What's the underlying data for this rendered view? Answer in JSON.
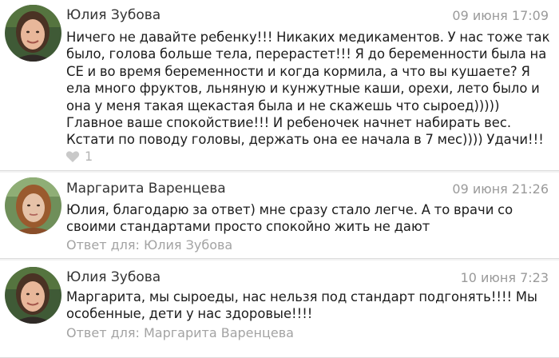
{
  "comments": [
    {
      "author": "Юлия Зубова",
      "date": "09 июня 17:09",
      "text": "Ничего не давайте ребенку!!! Никаких медикаментов. У нас тоже так было, голова больше тела, перерастет!!! Я до беременности была на СЕ и во время беременности и когда кормила, а что вы кушаете? Я ела много фруктов, льняную и кунжутные каши, орехи, лето было и она у меня такая щекастая была и не скажешь что сыроед))))) Главное ваше спокойствие!!! И ребеночек начнет набирать вес. Кстати по поводу головы, держать она ее начала в 7 мес)))) Удачи!!!",
      "likes": "1",
      "like_icon": "heart-icon",
      "avatar_colors": {
        "bg": "#3f5a36",
        "skin": "#e8b79a",
        "hair": "#4a3224"
      }
    },
    {
      "author": "Маргарита Варенцева",
      "date": "09 июня 21:26",
      "text": "Юлия, благодарю за ответ) мне сразу стало легче. А то врачи со своими стандартами просто спокойно жить не дают",
      "reply_to": "Ответ для: Юлия Зубова",
      "avatar_colors": {
        "bg": "#6f8f5a",
        "skin": "#e6c2a8",
        "hair": "#9a5a2e"
      }
    },
    {
      "author": "Юлия Зубова",
      "date": "10 июня 7:23",
      "text": "Маргарита, мы сыроеды, нас нельзя под стандарт подгонять!!!! Мы особенные, дети у нас здоровые!!!!",
      "reply_to": "Ответ для: Маргарита Варенцева",
      "avatar_colors": {
        "bg": "#3f5a36",
        "skin": "#e8b79a",
        "hair": "#4a3224"
      }
    }
  ]
}
